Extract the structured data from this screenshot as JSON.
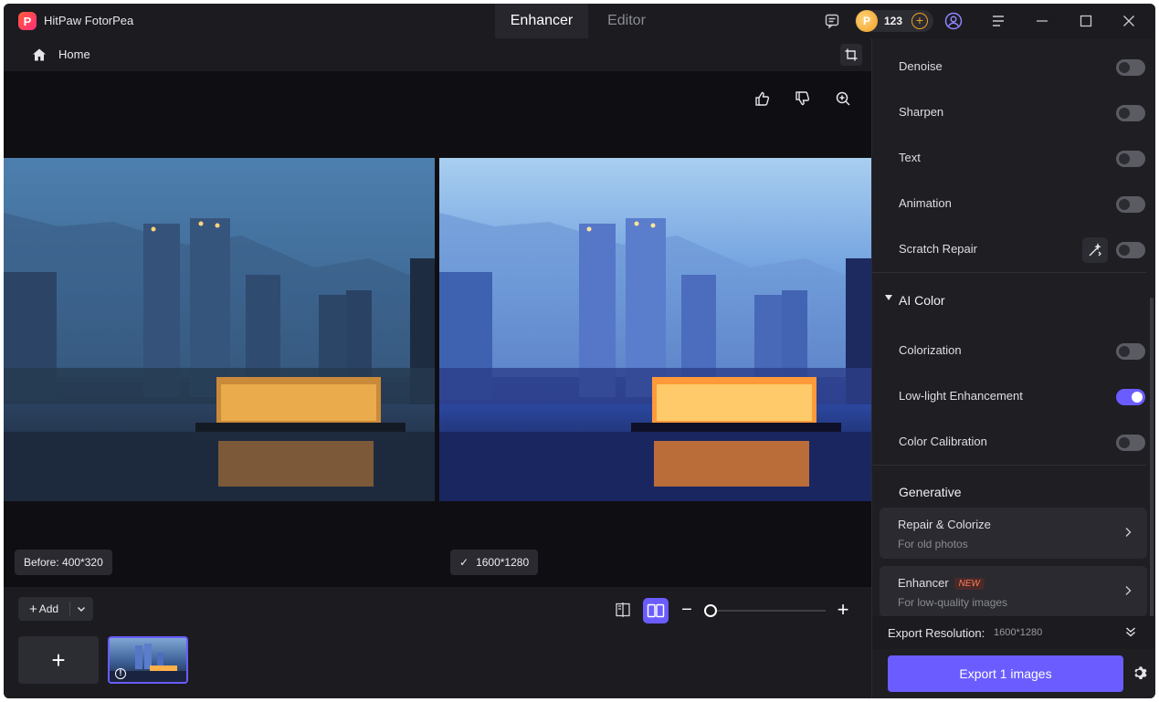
{
  "app": {
    "title": "HitPaw FotorPea",
    "logo_letter": "P"
  },
  "tabs": [
    {
      "label": "Enhancer",
      "active": true
    },
    {
      "label": "Editor",
      "active": false
    }
  ],
  "titlebar": {
    "coins": "123",
    "coin_letter": "P",
    "icons": [
      "message-icon",
      "coin-icon",
      "add-coins-icon",
      "account-icon",
      "menu-icon",
      "minimize-icon",
      "maximize-icon",
      "close-icon"
    ]
  },
  "breadcrumb": {
    "home_label": "Home"
  },
  "preview": {
    "before_caption": "Before: 400*320",
    "after_caption": "1600*1280",
    "after_check": "✓"
  },
  "bottombar": {
    "add_label": "Add",
    "add_plus": "+",
    "zoom_minus": "−",
    "zoom_plus": "+",
    "zoom_level": 0.0,
    "thumb_add": "+",
    "thumb_info": "!"
  },
  "panel": {
    "ai_repair_options": [
      {
        "label": "Denoise",
        "on": false
      },
      {
        "label": "Sharpen",
        "on": false
      },
      {
        "label": "Text",
        "on": false
      },
      {
        "label": "Animation",
        "on": false
      },
      {
        "label": "Scratch Repair",
        "on": false
      }
    ],
    "ai_color": {
      "title": "AI Color",
      "options": [
        {
          "label": "Colorization",
          "on": false
        },
        {
          "label": "Low-light Enhancement",
          "on": true
        },
        {
          "label": "Color Calibration",
          "on": false
        }
      ]
    },
    "generative": {
      "title": "Generative",
      "cards": [
        {
          "title": "Repair & Colorize",
          "subtitle": "For old photos",
          "badge": ""
        },
        {
          "title": "Enhancer",
          "subtitle": "For low-quality images",
          "badge": "NEW"
        }
      ]
    },
    "export_resolution_label": "Export Resolution:",
    "export_resolution_value": "1600*1280",
    "export_button": "Export 1 images"
  },
  "colors": {
    "accent": "#6a5cff",
    "background": "#141418",
    "panel": "#1e1e23",
    "new_badge": "#ff7a5a"
  }
}
